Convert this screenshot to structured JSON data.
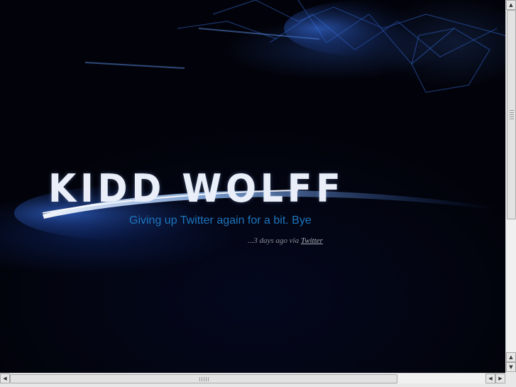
{
  "site": {
    "logo_text": "KIDD WOLFF"
  },
  "tweet": {
    "text": "Giving up Twitter again for a bit. Bye",
    "meta_prefix": "...3 days ago via ",
    "source_link": "Twitter"
  },
  "scrollbars": {
    "up_arrow": "▲",
    "down_arrow": "▼",
    "left_arrow": "◀",
    "right_arrow": "▶"
  },
  "colors": {
    "background": "#02030a",
    "tweet_text": "#1d76bf",
    "logo": "#e9eef8",
    "meta": "#8b8f99"
  }
}
